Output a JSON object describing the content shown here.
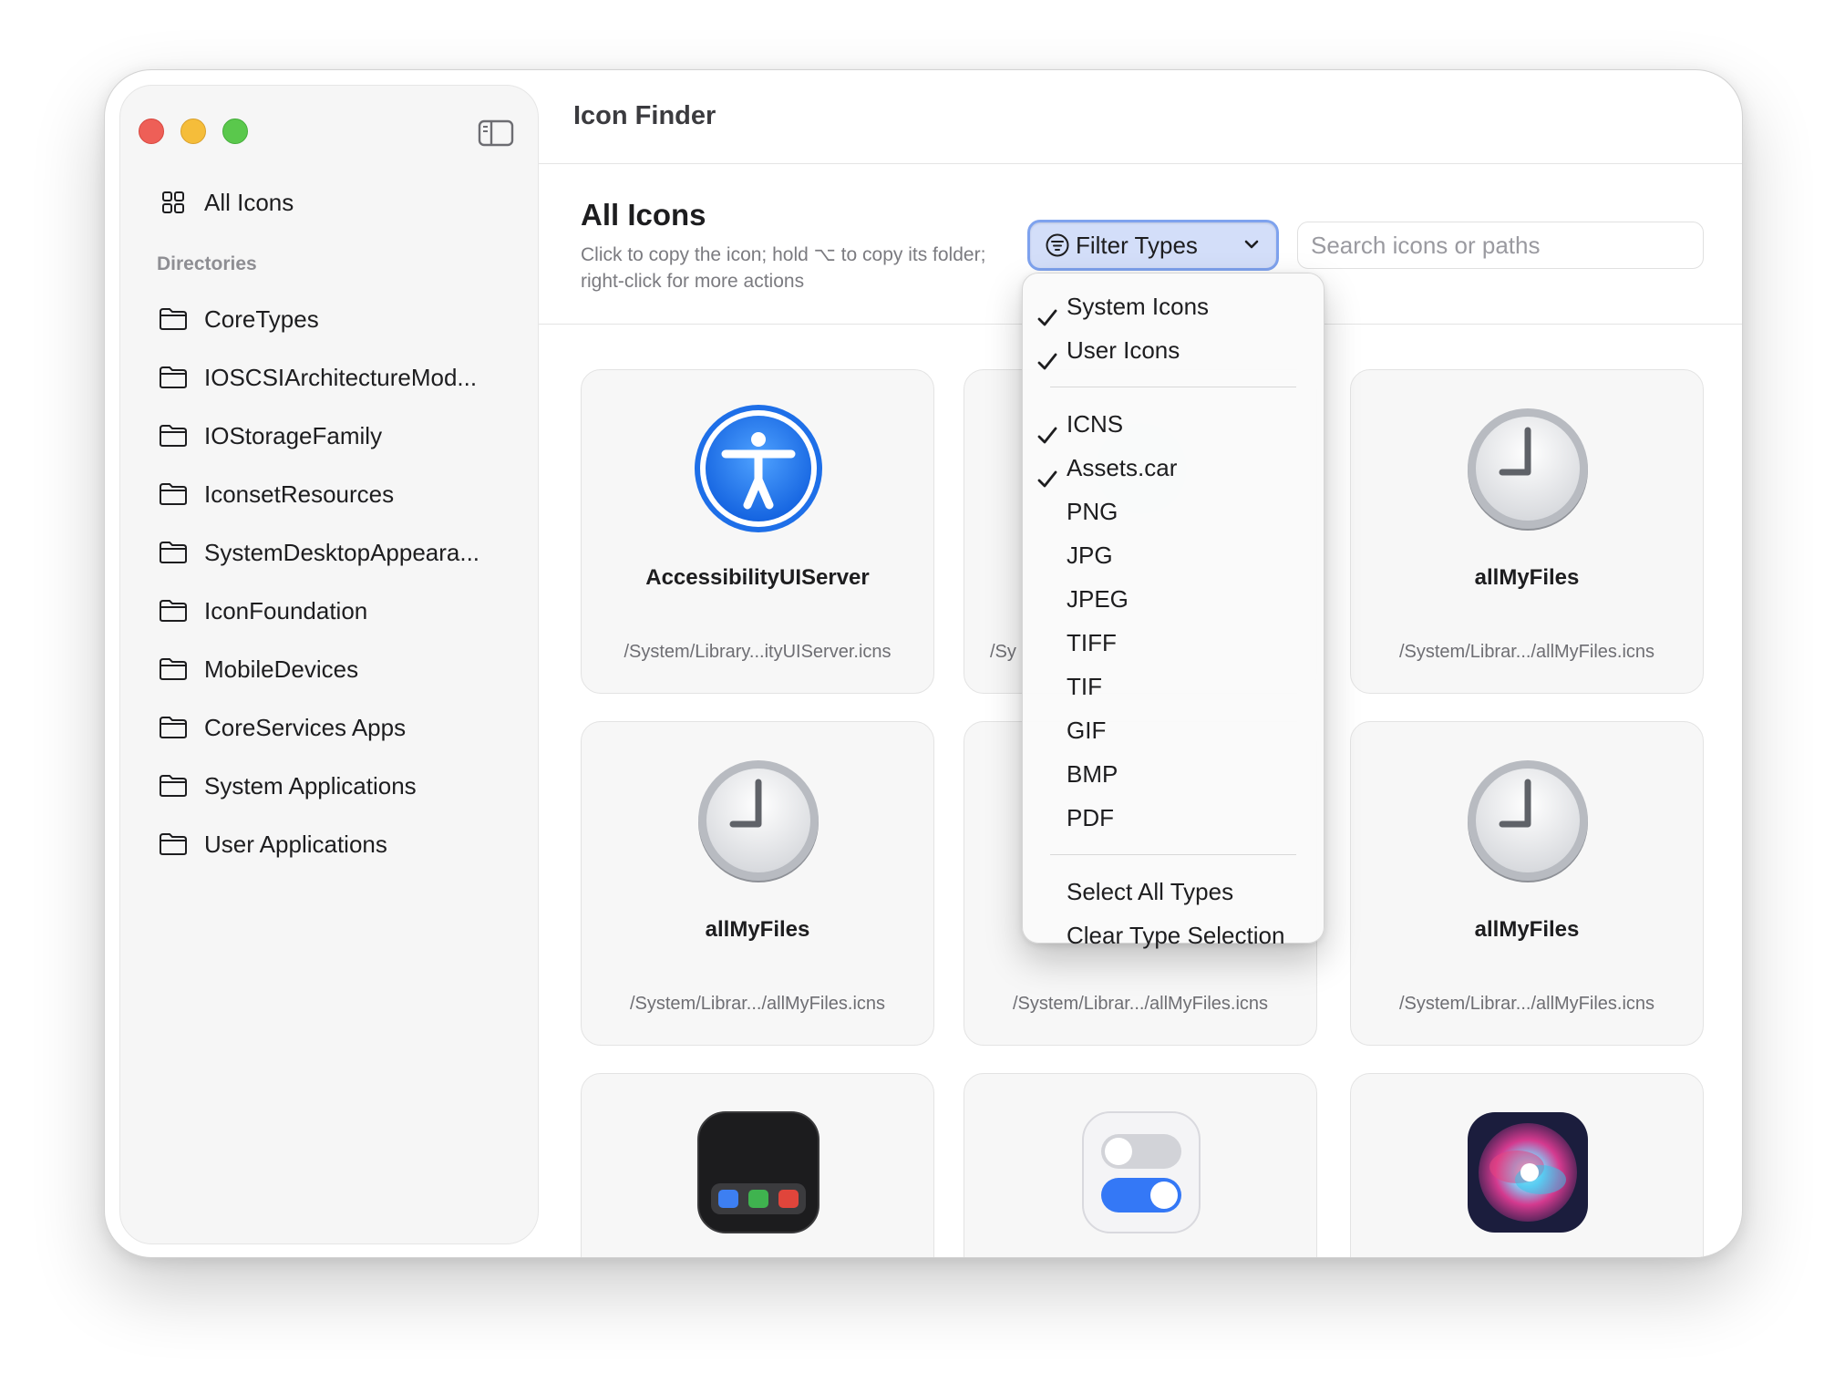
{
  "window": {
    "title": "Icon Finder"
  },
  "sidebar": {
    "all_icons_label": "All Icons",
    "section_label": "Directories",
    "directories": [
      {
        "label": "CoreTypes"
      },
      {
        "label": "IOSCSIArchitectureMod..."
      },
      {
        "label": "IOStorageFamily"
      },
      {
        "label": "IconsetResources"
      },
      {
        "label": "SystemDesktopAppeara..."
      },
      {
        "label": "IconFoundation"
      },
      {
        "label": "MobileDevices"
      },
      {
        "label": "CoreServices Apps"
      },
      {
        "label": "System Applications"
      },
      {
        "label": "User Applications"
      }
    ]
  },
  "main": {
    "title": "All Icons",
    "subtitle": "Click to copy the icon; hold ⌥ to copy its folder; right-click for more actions",
    "filter_label": "Filter Types",
    "search_placeholder": "Search icons or paths"
  },
  "icons": [
    {
      "name": "AccessibilityUIServer",
      "path": "/System/Library...ityUIServer.icns",
      "icon": "accessibility-icon"
    },
    {
      "name": "",
      "path": "/Sy",
      "icon": "blurred-icon"
    },
    {
      "name": "allMyFiles",
      "path": "/System/Librar.../allMyFiles.icns",
      "icon": "clock-icon"
    },
    {
      "name": "allMyFiles",
      "path": "/System/Librar.../allMyFiles.icns",
      "icon": "clock-icon"
    },
    {
      "name": "",
      "path": "/System/Librar.../allMyFiles.icns",
      "icon": "clock-icon"
    },
    {
      "name": "allMyFiles",
      "path": "/System/Librar.../allMyFiles.icns",
      "icon": "clock-icon"
    },
    {
      "name": "",
      "path": "",
      "icon": "mission-control-icon"
    },
    {
      "name": "",
      "path": "",
      "icon": "toggles-icon"
    },
    {
      "name": "",
      "path": "",
      "icon": "siri-icon"
    }
  ],
  "filter_menu": {
    "source_items": [
      {
        "label": "System Icons",
        "checked": true
      },
      {
        "label": "User Icons",
        "checked": true
      }
    ],
    "type_items": [
      {
        "label": "ICNS",
        "checked": true
      },
      {
        "label": "Assets.car",
        "checked": true
      },
      {
        "label": "PNG",
        "checked": false
      },
      {
        "label": "JPG",
        "checked": false
      },
      {
        "label": "JPEG",
        "checked": false
      },
      {
        "label": "TIFF",
        "checked": false
      },
      {
        "label": "TIF",
        "checked": false
      },
      {
        "label": "GIF",
        "checked": false
      },
      {
        "label": "BMP",
        "checked": false
      },
      {
        "label": "PDF",
        "checked": false
      }
    ],
    "actions": [
      {
        "label": "Select All Types"
      },
      {
        "label": "Clear Type Selection"
      }
    ]
  },
  "colors": {
    "accent": "#3478f6",
    "close": "#ee5f57",
    "minimize": "#f5bd3a",
    "zoom": "#5ac84c"
  }
}
